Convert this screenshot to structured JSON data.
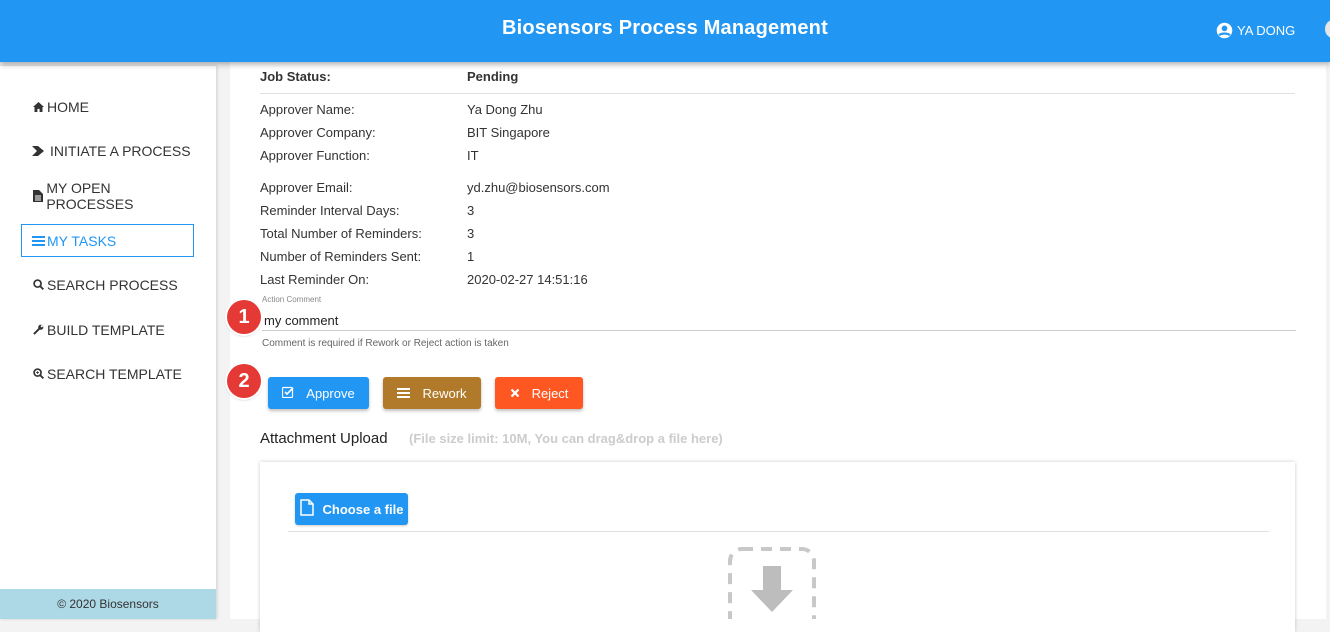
{
  "header": {
    "title": "Biosensors Process Management",
    "user": "YA DONG"
  },
  "sidebar": {
    "items": [
      {
        "label": "HOME",
        "icon": "home-icon",
        "active": false
      },
      {
        "label": "INITIATE A PROCESS",
        "icon": "play-icon",
        "active": false
      },
      {
        "label": "MY OPEN PROCESSES",
        "icon": "file-icon",
        "active": false
      },
      {
        "label": "MY TASKS",
        "icon": "tasks-icon",
        "active": true
      },
      {
        "label": "SEARCH PROCESS",
        "icon": "search-icon",
        "active": false
      },
      {
        "label": "BUILD TEMPLATE",
        "icon": "wrench-icon",
        "active": false
      },
      {
        "label": "SEARCH TEMPLATE",
        "icon": "search-plus-icon",
        "active": false
      }
    ],
    "footer": "© 2020 Biosensors"
  },
  "job": {
    "status_label": "Job Status:",
    "status_value": "Pending",
    "approver_name_label": "Approver Name:",
    "approver_name": "Ya Dong Zhu",
    "approver_company_label": "Approver Company:",
    "approver_company": "BIT Singapore",
    "approver_function_label": "Approver Function:",
    "approver_function": "IT",
    "approver_email_label": "Approver Email:",
    "approver_email": "yd.zhu@biosensors.com",
    "reminder_interval_label": "Reminder Interval Days:",
    "reminder_interval": "3",
    "total_reminders_label": "Total Number of Reminders:",
    "total_reminders": "3",
    "reminders_sent_label": "Number of Reminders Sent:",
    "reminders_sent": "1",
    "last_reminder_label": "Last Reminder On:",
    "last_reminder": "2020-02-27 14:51:16"
  },
  "comment": {
    "label": "Action Comment",
    "value": "my comment",
    "hint": "Comment is required if Rework or Reject action is taken"
  },
  "actions": {
    "approve": "Approve",
    "rework": "Rework",
    "reject": "Reject"
  },
  "attachment": {
    "title": "Attachment Upload",
    "hint": "(File size limit: 10M, You can drag&drop a file here)",
    "choose": "Choose a file"
  },
  "annotations": {
    "badge1": "1",
    "badge2": "2"
  },
  "colors": {
    "primary": "#2196f3",
    "rework": "#b07a2a",
    "reject": "#ff5722",
    "badge": "#e53935",
    "footer": "#add8e6"
  }
}
